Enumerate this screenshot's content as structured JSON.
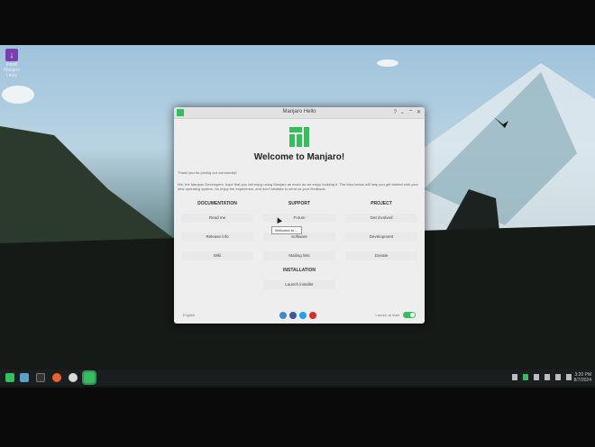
{
  "desktop": {
    "icon_label": "Install Manjaro Linux"
  },
  "window": {
    "title": "Manjaro Hello",
    "controls": [
      "?",
      "⌄",
      "⌃",
      "✕"
    ],
    "heading": "Welcome to Manjaro!",
    "intro": "Thank you for joining our community!",
    "body": "We, the Manjaro Developers, hope that you will enjoy using Manjaro as much as we enjoy building it. The links below will help you get started with your new operating system. So enjoy the experience, and don't hesitate to send us your feedback.",
    "columns": [
      {
        "header": "DOCUMENTATION",
        "buttons": [
          "Read me",
          "Release info",
          "Wiki"
        ]
      },
      {
        "header": "SUPPORT",
        "buttons": [
          "Forum",
          "Software",
          "Mailing lists"
        ]
      },
      {
        "header": "PROJECT",
        "buttons": [
          "Get involved",
          "Development",
          "Donate"
        ]
      }
    ],
    "installation": {
      "header": "INSTALLATION",
      "button": "Launch installer"
    },
    "tooltip": "Welcome to ...",
    "language": "English",
    "launch_at_start": "Launch at start",
    "social_colors": [
      "#3b8ad9",
      "#3b5998",
      "#1da1f2",
      "#e02a2a"
    ],
    "accent": "#35bf5c"
  },
  "taskbar": {
    "apps": [
      "menu",
      "files",
      "terminal",
      "firefox",
      "software",
      "manjaro-hello"
    ],
    "time": "3:20 PM",
    "date": "8/7/2024"
  }
}
